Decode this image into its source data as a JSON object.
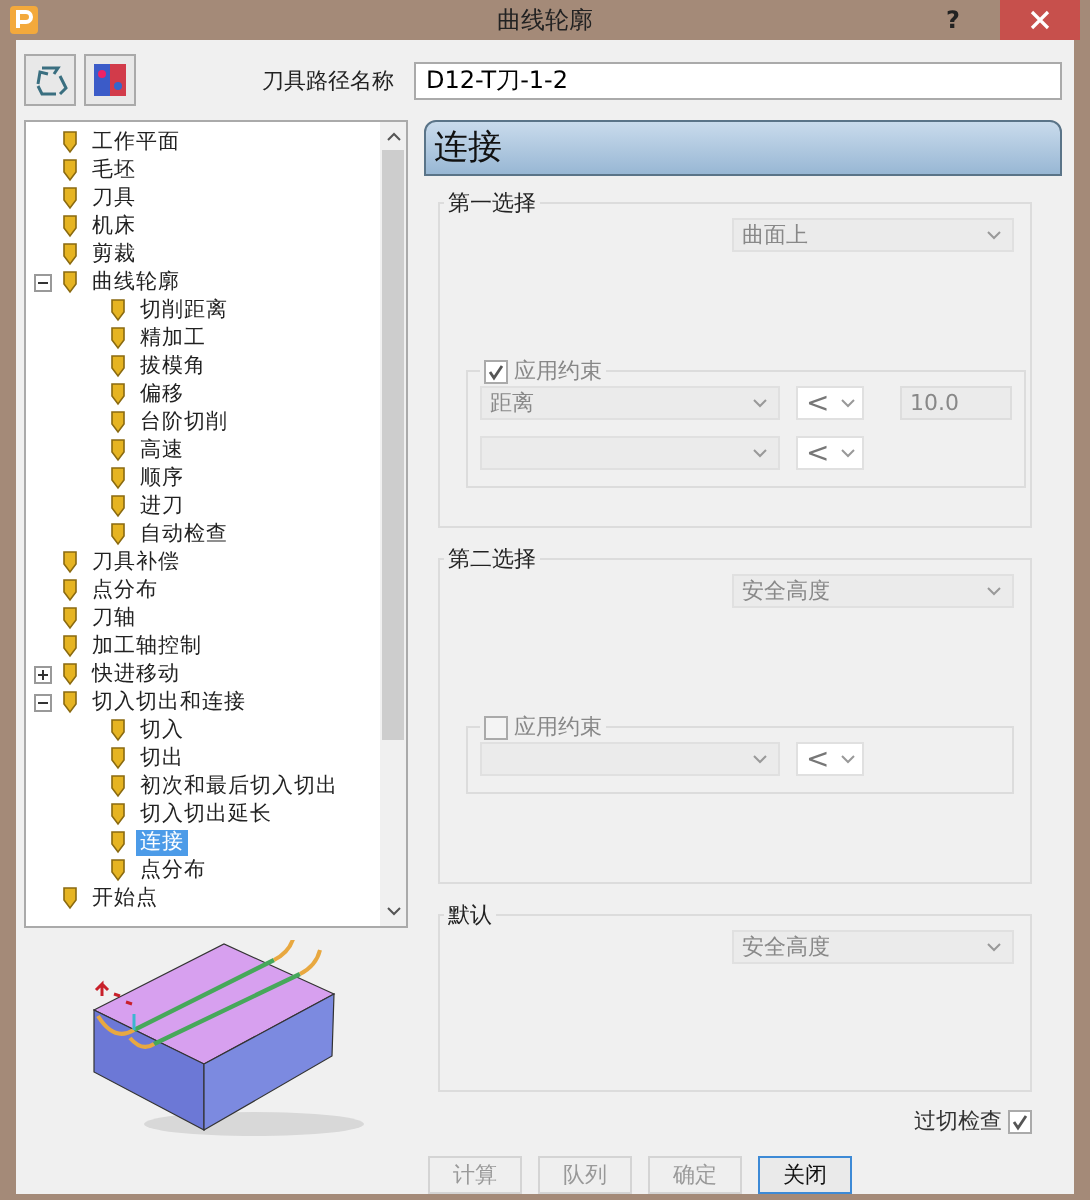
{
  "window": {
    "title": "曲线轮廓",
    "help": "?"
  },
  "toolbar": {
    "name_label": "刀具路径名称",
    "name_value": "D12-T刀-1-2"
  },
  "tree": [
    {
      "label": "工作平面",
      "selected": false
    },
    {
      "label": "毛坯",
      "selected": false
    },
    {
      "label": "刀具",
      "selected": false
    },
    {
      "label": "机床",
      "selected": false
    },
    {
      "label": "剪裁",
      "selected": false
    },
    {
      "label": "曲线轮廓",
      "selected": false,
      "expanded": true,
      "children": [
        {
          "label": "切削距离",
          "selected": false
        },
        {
          "label": "精加工",
          "selected": false
        },
        {
          "label": "拔模角",
          "selected": false
        },
        {
          "label": "偏移",
          "selected": false
        },
        {
          "label": "台阶切削",
          "selected": false
        },
        {
          "label": "高速",
          "selected": false
        },
        {
          "label": "顺序",
          "selected": false
        },
        {
          "label": "进刀",
          "selected": false
        },
        {
          "label": "自动检查",
          "selected": false
        }
      ]
    },
    {
      "label": "刀具补偿",
      "selected": false
    },
    {
      "label": "点分布",
      "selected": false
    },
    {
      "label": "刀轴",
      "selected": false
    },
    {
      "label": "加工轴控制",
      "selected": false
    },
    {
      "label": "快进移动",
      "selected": false,
      "expanded": false
    },
    {
      "label": "切入切出和连接",
      "selected": false,
      "expanded": true,
      "children": [
        {
          "label": "切入",
          "selected": false
        },
        {
          "label": "切出",
          "selected": false
        },
        {
          "label": "初次和最后切入切出",
          "selected": false
        },
        {
          "label": "切入切出延长",
          "selected": false
        },
        {
          "label": "连接",
          "selected": true
        },
        {
          "label": "点分布",
          "selected": false
        }
      ]
    },
    {
      "label": "开始点",
      "selected": false
    }
  ],
  "panel": {
    "title": "连接",
    "groups": [
      {
        "title": "第一选择",
        "method": "曲面上",
        "constraint": {
          "label": "应用约束",
          "checked": true,
          "rows": [
            {
              "field": "距离",
              "operator": "<",
              "value": "10.0"
            },
            {
              "operator": "<"
            }
          ]
        }
      },
      {
        "title": "第二选择",
        "method": "安全高度",
        "constraint": {
          "label": "应用约束",
          "checked": false,
          "rows": [
            {
              "operator": "<"
            }
          ]
        }
      },
      {
        "title": "默认",
        "method": "安全高度"
      }
    ]
  },
  "gouge_check": {
    "label": "过切检查",
    "checked": true
  },
  "buttons": [
    {
      "label": "计算",
      "disabled": true
    },
    {
      "label": "队列",
      "disabled": true
    },
    {
      "label": "确定",
      "disabled": true
    },
    {
      "label": "关闭",
      "disabled": false
    }
  ]
}
